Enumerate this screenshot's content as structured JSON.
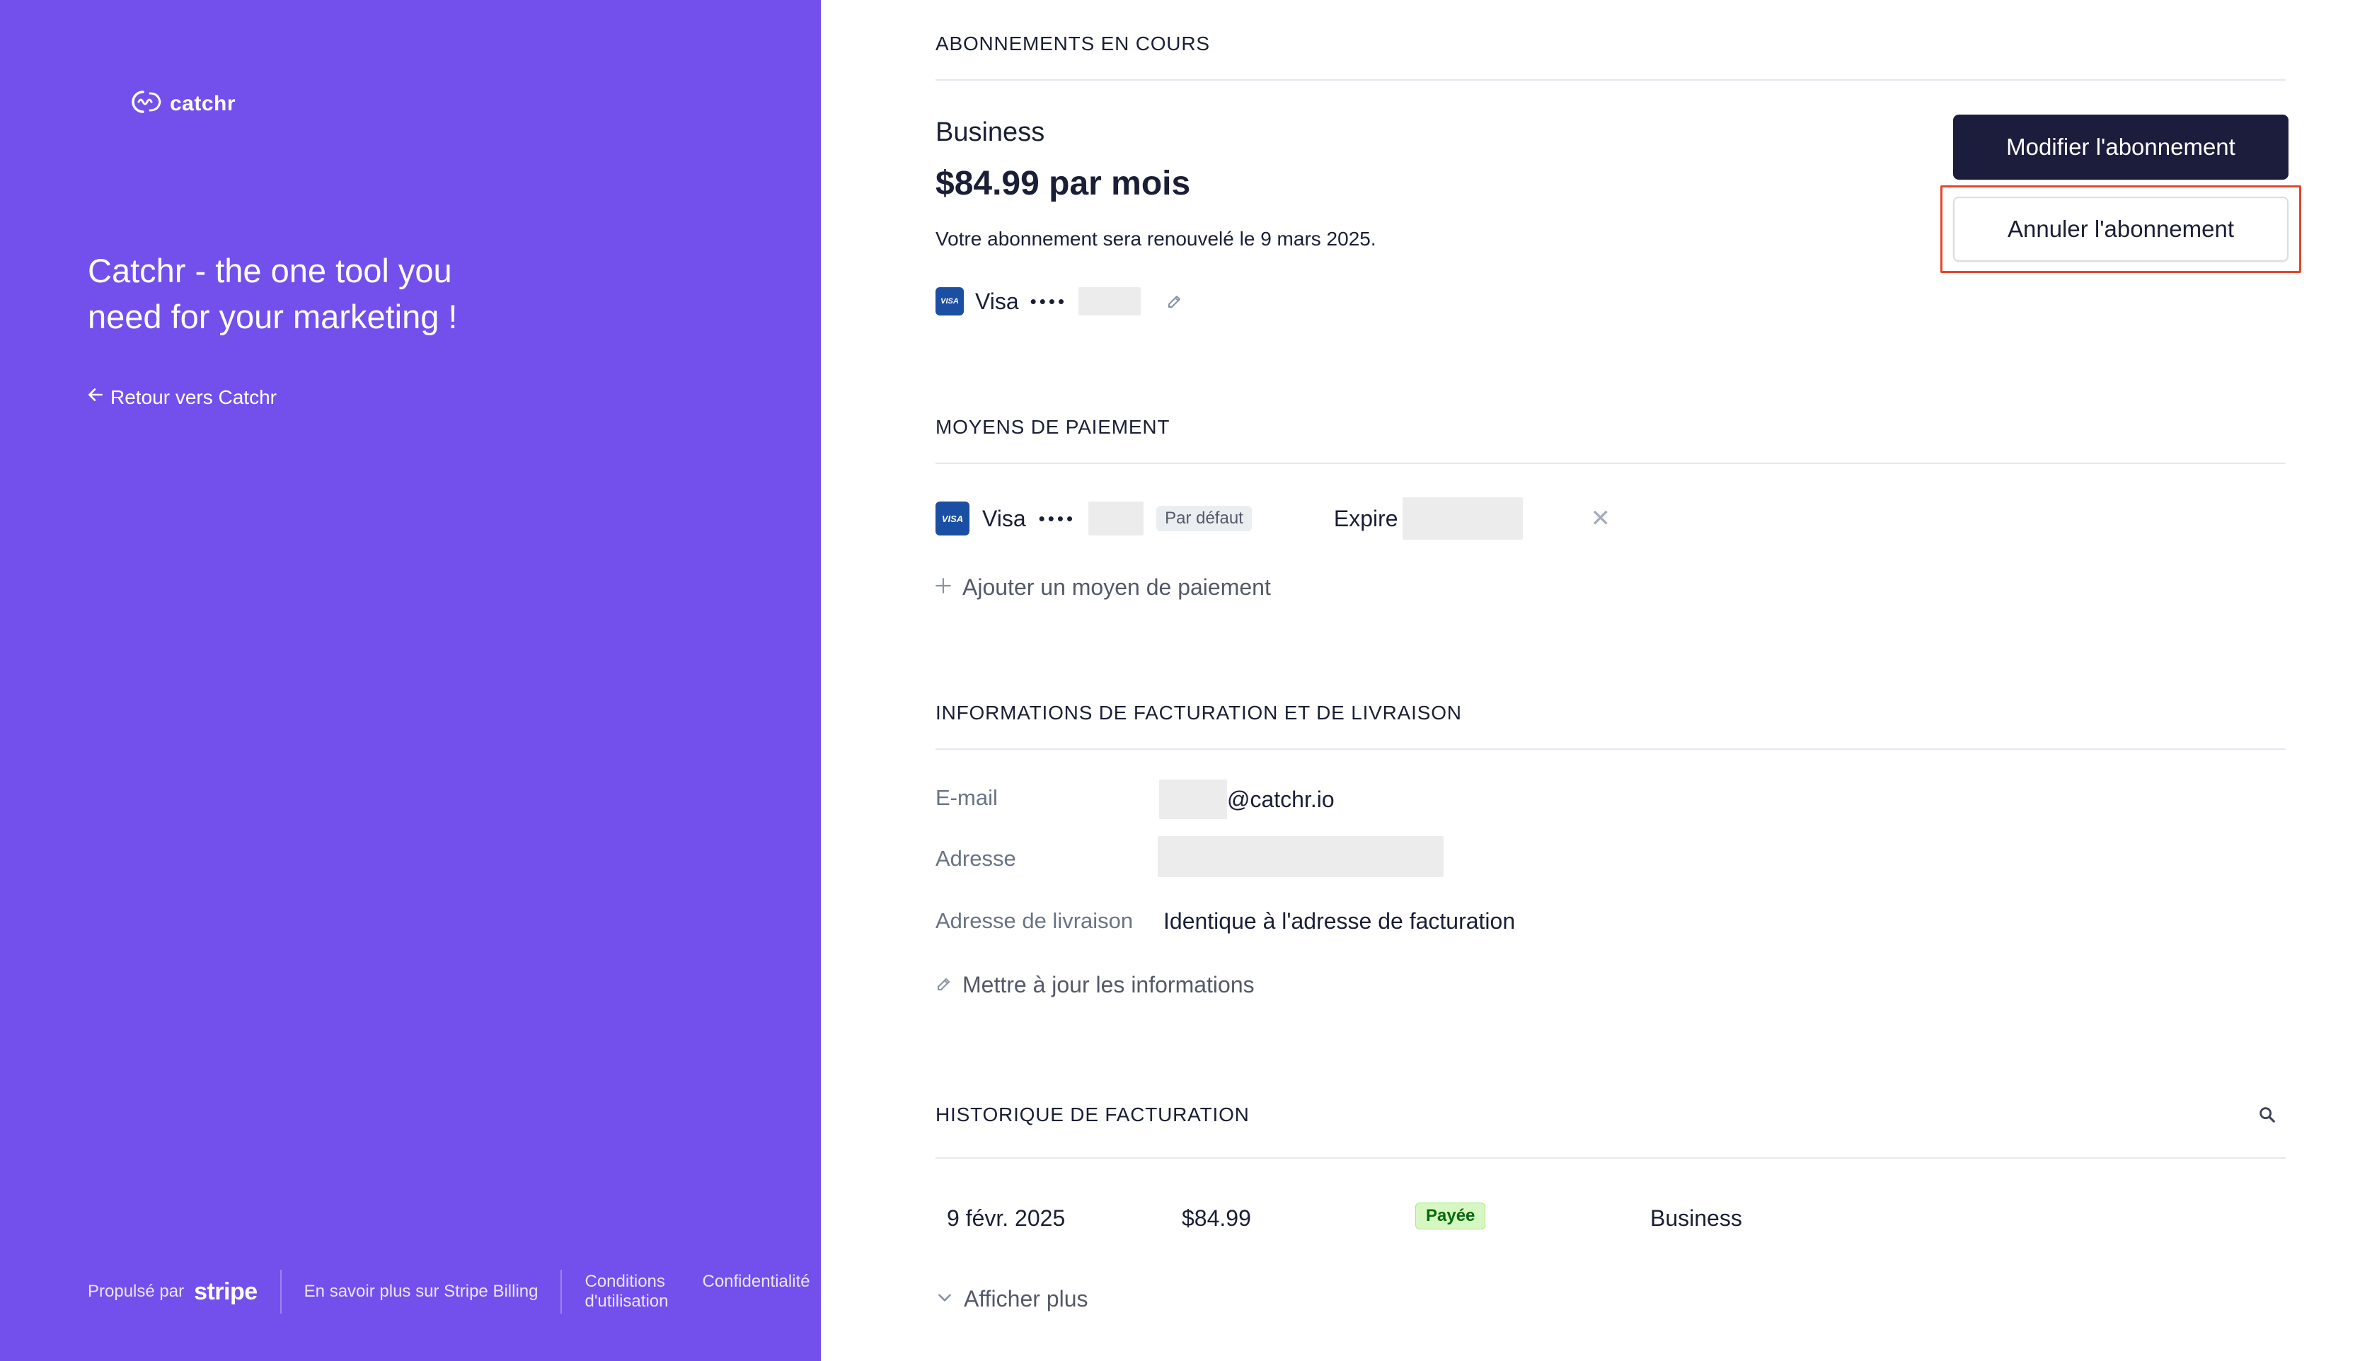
{
  "brand": {
    "logo_text": "catchr",
    "tagline": "Catchr - the one tool you need for your marketing !",
    "back_link": "Retour vers Catchr"
  },
  "footer": {
    "powered_by": "Propulsé par",
    "stripe_word": "stripe",
    "learn_more": "En savoir plus sur Stripe Billing",
    "terms": "Conditions d'utilisation",
    "privacy": "Confidentialité"
  },
  "subscriptions": {
    "title": "ABONNEMENTS EN COURS",
    "plan_name": "Business",
    "price": "$84.99 par mois",
    "renewal_text": "Votre abonnement sera renouvelé le 9 mars 2025.",
    "card_brand": "Visa",
    "card_dots": "••••",
    "modify_button": "Modifier l'abonnement",
    "cancel_button": "Annuler l'abonnement"
  },
  "payment_methods": {
    "title": "MOYENS DE PAIEMENT",
    "card_brand": "Visa",
    "card_dots": "••••",
    "default_badge": "Par défaut",
    "expire_label": "Expire",
    "remove_symbol": "✕",
    "add_link": "Ajouter un moyen de paiement"
  },
  "billing_info": {
    "title": "INFORMATIONS DE FACTURATION ET DE LIVRAISON",
    "email_label": "E-mail",
    "email_value": "@catchr.io",
    "address_label": "Adresse",
    "shipping_label": "Adresse de livraison",
    "shipping_value": "Identique à l'adresse de facturation",
    "update_link": "Mettre à jour les informations"
  },
  "history": {
    "title": "HISTORIQUE DE FACTURATION",
    "rows": [
      {
        "date": "9 févr. 2025",
        "amount": "$84.99",
        "status": "Payée",
        "plan": "Business"
      }
    ],
    "show_more": "Afficher plus"
  },
  "colors": {
    "brand_purple": "#7350ec",
    "primary_button": "#1c1c3c",
    "highlight_border": "#e5462a",
    "paid_badge_bg": "#d7f7c2"
  }
}
